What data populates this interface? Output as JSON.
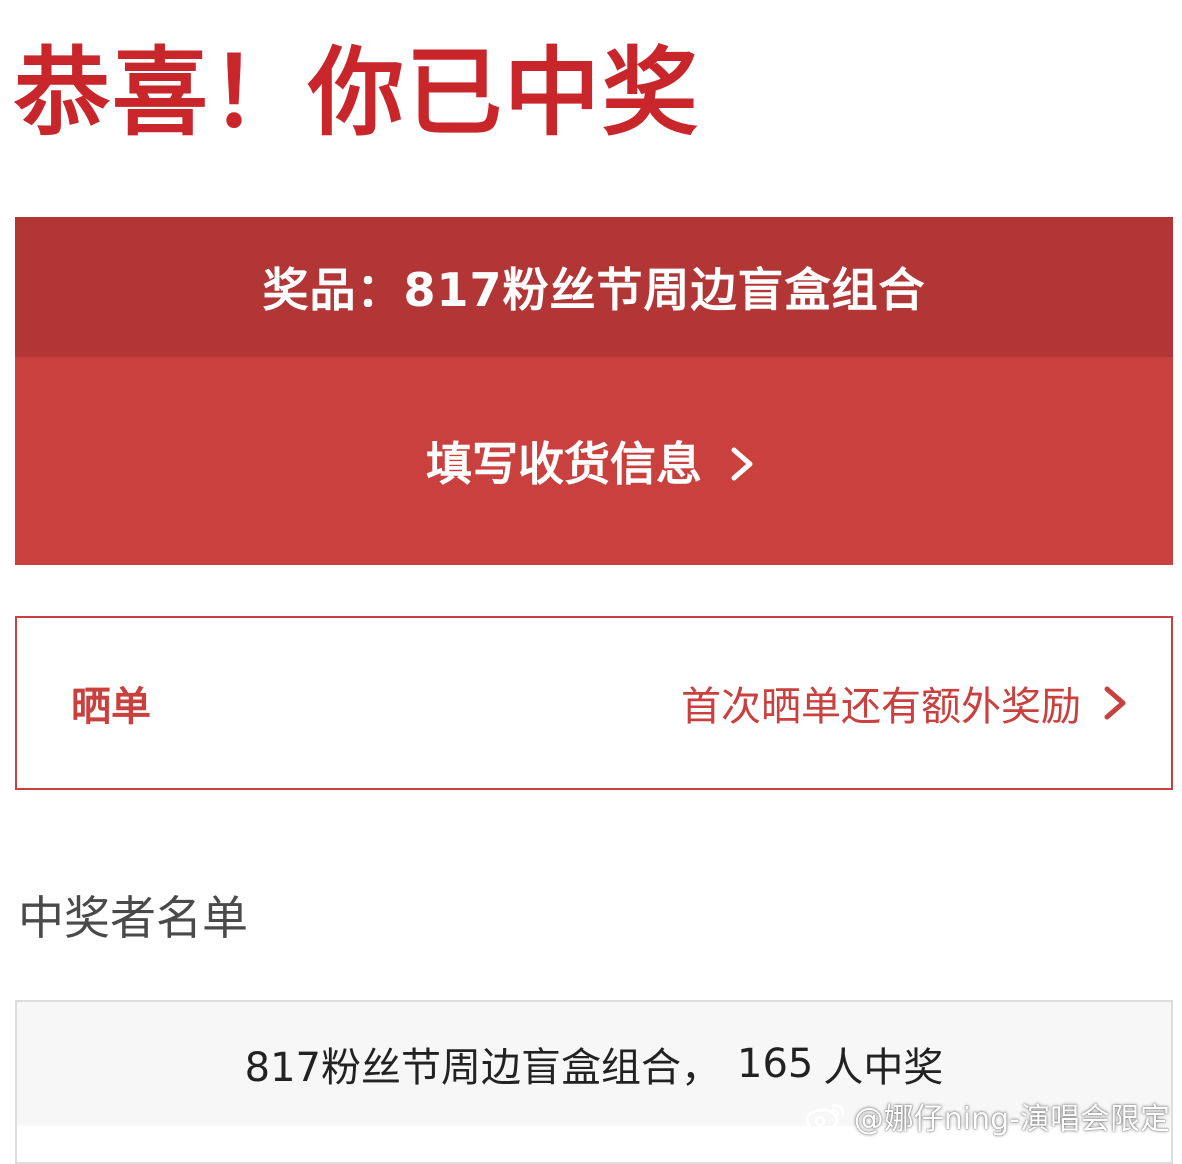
{
  "headline": "恭喜！你已中奖",
  "prize": {
    "label": "奖品：817粉丝节周边盲盒组合"
  },
  "fill_info": {
    "label": "填写收货信息",
    "icon": "chevron-right-icon"
  },
  "share": {
    "title": "晒单",
    "hint": "首次晒单还有额外奖励",
    "icon": "chevron-right-icon"
  },
  "winners": {
    "heading": "中奖者名单",
    "prize_name": "817粉丝节周边盲盒组合，",
    "count": "165",
    "suffix": "人中奖"
  },
  "watermark": {
    "text": "@娜仔ning-演唱会限定",
    "icon": "weibo-logo-icon"
  },
  "colors": {
    "headline": "#c8262a",
    "prize_bar": "#b33636",
    "button": "#c9403e",
    "share_border": "#c9403e",
    "text_dark": "#222222",
    "text_gray": "#4a4a4a"
  }
}
